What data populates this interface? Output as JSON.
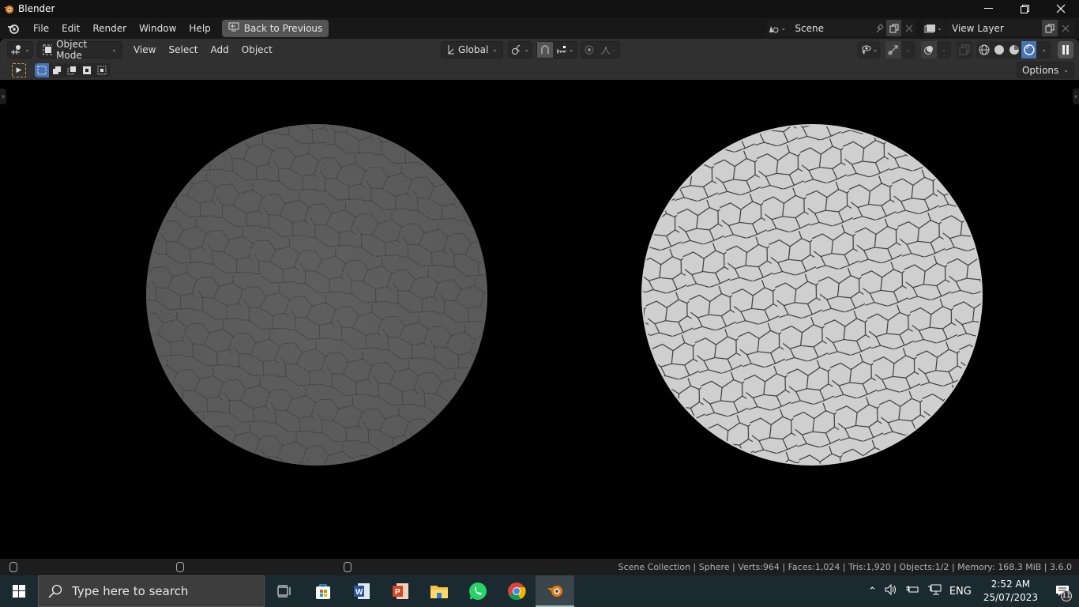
{
  "window": {
    "title": "Blender",
    "controls": [
      "minimize",
      "restore",
      "close"
    ]
  },
  "topbar": {
    "menus": [
      "File",
      "Edit",
      "Render",
      "Window",
      "Help"
    ],
    "back_button": "Back to Previous",
    "scene": {
      "value": "Scene"
    },
    "view_layer": {
      "value": "View Layer"
    }
  },
  "header3d": {
    "mode": "Object Mode",
    "menus": [
      "View",
      "Select",
      "Add",
      "Object"
    ],
    "transform_orientation": "Global",
    "shading_active": "rendered"
  },
  "toolrow": {
    "options_label": "Options"
  },
  "viewport": {
    "objects": [
      {
        "name": "sphere-left",
        "shade": "#5e5e5e"
      },
      {
        "name": "sphere-right",
        "shade": "#cfcfcf"
      }
    ]
  },
  "statusbar": {
    "stats": "Scene Collection | Sphere | Verts:964 | Faces:1,024 | Tris:1,920 | Objects:1/2 | Memory: 168.3 MiB | 3.6.0"
  },
  "taskbar": {
    "search_placeholder": "Type here to search",
    "apps": [
      "task-view",
      "microsoft-store",
      "word",
      "powerpoint",
      "file-explorer",
      "whatsapp",
      "chrome",
      "blender"
    ],
    "language": "ENG",
    "time": "2:52 AM",
    "date": "25/07/2023",
    "notifications": "11"
  }
}
